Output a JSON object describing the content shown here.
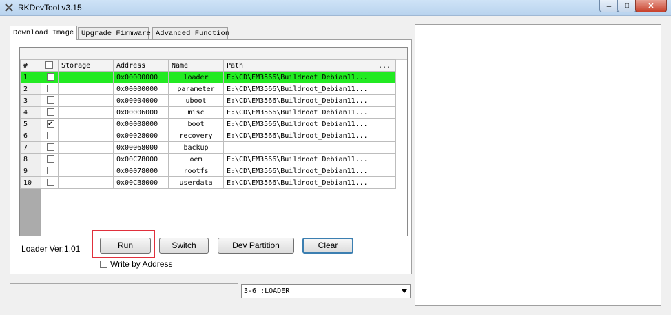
{
  "window": {
    "title": "RKDevTool v3.15",
    "controls": {
      "minimize": "─",
      "maximize": "□",
      "close": "✕"
    }
  },
  "tabs": [
    {
      "label": "Download Image",
      "active": true
    },
    {
      "label": "Upgrade Firmware",
      "active": false
    },
    {
      "label": "Advanced Function",
      "active": false
    }
  ],
  "table": {
    "headers": [
      "#",
      "",
      "Storage",
      "Address",
      "Name",
      "Path",
      "..."
    ],
    "rows": [
      {
        "num": "1",
        "checked": false,
        "storage": "",
        "address": "0x00000000",
        "name": "loader",
        "path": "E:\\CD\\EM3566\\Buildroot_Debian11...",
        "selected": true
      },
      {
        "num": "2",
        "checked": false,
        "storage": "",
        "address": "0x00000000",
        "name": "parameter",
        "path": "E:\\CD\\EM3566\\Buildroot_Debian11...",
        "selected": false
      },
      {
        "num": "3",
        "checked": false,
        "storage": "",
        "address": "0x00004000",
        "name": "uboot",
        "path": "E:\\CD\\EM3566\\Buildroot_Debian11...",
        "selected": false
      },
      {
        "num": "4",
        "checked": false,
        "storage": "",
        "address": "0x00006000",
        "name": "misc",
        "path": "E:\\CD\\EM3566\\Buildroot_Debian11...",
        "selected": false
      },
      {
        "num": "5",
        "checked": true,
        "storage": "",
        "address": "0x00008000",
        "name": "boot",
        "path": "E:\\CD\\EM3566\\Buildroot_Debian11...",
        "selected": false
      },
      {
        "num": "6",
        "checked": false,
        "storage": "",
        "address": "0x00028000",
        "name": "recovery",
        "path": "E:\\CD\\EM3566\\Buildroot_Debian11...",
        "selected": false
      },
      {
        "num": "7",
        "checked": false,
        "storage": "",
        "address": "0x00068000",
        "name": "backup",
        "path": "",
        "selected": false
      },
      {
        "num": "8",
        "checked": false,
        "storage": "",
        "address": "0x00C78000",
        "name": "oem",
        "path": "E:\\CD\\EM3566\\Buildroot_Debian11...",
        "selected": false
      },
      {
        "num": "9",
        "checked": false,
        "storage": "",
        "address": "0x00078000",
        "name": "rootfs",
        "path": "E:\\CD\\EM3566\\Buildroot_Debian11...",
        "selected": false
      },
      {
        "num": "10",
        "checked": false,
        "storage": "",
        "address": "0x00CB8000",
        "name": "userdata",
        "path": "E:\\CD\\EM3566\\Buildroot_Debian11...",
        "selected": false
      }
    ]
  },
  "loader_version": "Loader Ver:1.01",
  "buttons": {
    "run": "Run",
    "switch": "Switch",
    "dev_partition": "Dev Partition",
    "clear": "Clear"
  },
  "write_by_address": {
    "label": "Write by Address",
    "checked": false
  },
  "status_text": "",
  "device_combo": {
    "value": "3-6 :LOADER"
  },
  "colors": {
    "selected_row": "#22ea22",
    "highlight_border": "#e0303c"
  }
}
